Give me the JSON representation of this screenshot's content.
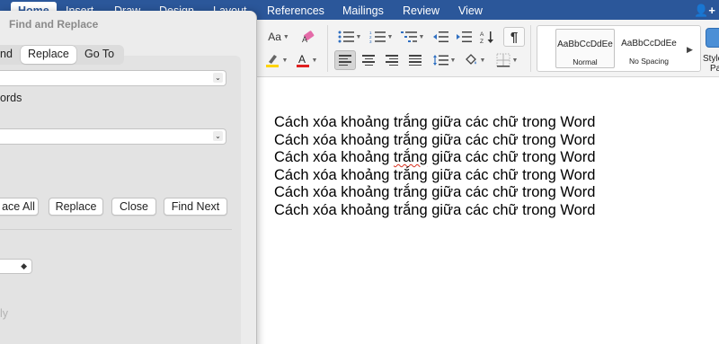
{
  "ribbon": {
    "tabs": [
      {
        "label": "Home",
        "active": true
      },
      {
        "label": "Insert"
      },
      {
        "label": "Draw"
      },
      {
        "label": "Design"
      },
      {
        "label": "Layout"
      },
      {
        "label": "References"
      },
      {
        "label": "Mailings"
      },
      {
        "label": "Review"
      },
      {
        "label": "View"
      }
    ],
    "font_case_button": "Aa",
    "styles": [
      {
        "sample": "AaBbCcDdEe",
        "name": "Normal",
        "selected": true
      },
      {
        "sample": "AaBbCcDdEe",
        "name": "No Spacing"
      }
    ],
    "styles_pane": {
      "line1": "Styles",
      "line2": "Pane"
    },
    "colors": {
      "tab_bar": "#2b579a",
      "highlight": "#ffd400",
      "font_color": "#e02020"
    }
  },
  "dialog": {
    "title": "Find and Replace",
    "tabs": [
      {
        "label": "Find",
        "visible": "nd"
      },
      {
        "label": "Replace",
        "active": true
      },
      {
        "label": "Go To"
      }
    ],
    "find_field": {
      "value": ""
    },
    "match_words_partial": "ords",
    "replace_field": {
      "value": ""
    },
    "buttons": {
      "replace_all": "Replace All",
      "replace_all_visible": "ace All",
      "replace": "Replace",
      "close": "Close",
      "find_next": "Find Next"
    },
    "faded_text_visible": "ly"
  },
  "document": {
    "lines": [
      "Cách xóa khoảng trắng giữa các chữ trong Word",
      "Cách xóa khoảng trắng giữa các chữ trong Word",
      "Cách xóa khoảng trắng giữa các chữ trong Word",
      "Cách xóa khoảng trắng giữa các chữ trong Word",
      "Cách xóa khoảng trắng giữa các chữ trong Word",
      "Cách xóa khoảng trắng giữa các chữ trong Word"
    ],
    "misspelled_line": {
      "before": "Cách xóa khoảng ",
      "word": "trắng",
      "after": " giữa các chữ trong Word"
    }
  }
}
